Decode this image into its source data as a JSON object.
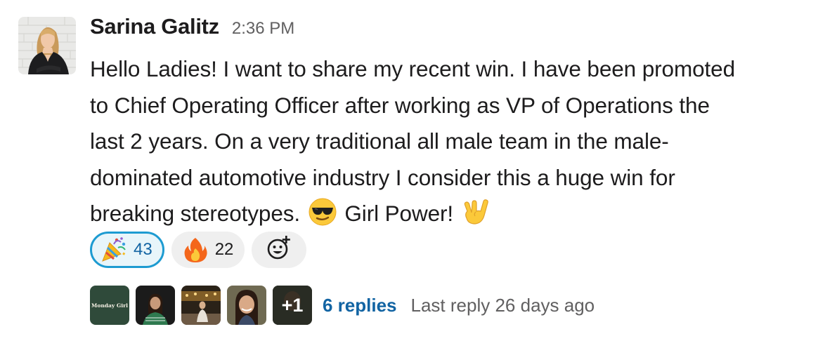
{
  "message": {
    "sender": "Sarina Galitz",
    "timestamp": "2:36 PM",
    "body_lines": [
      "Hello Ladies! I want to share my recent win. I have been promoted",
      "to Chief Operating Officer after working as VP of Operations the",
      "last 2 years. On a very traditional all male team in the male-",
      "dominated automotive industry I consider this a huge win for",
      "breaking stereotypes."
    ],
    "body_tail": "Girl Power!",
    "inline_emoji": [
      "sunglasses-emoji",
      "rock-on-hand-emoji"
    ]
  },
  "reactions": [
    {
      "emoji": "party-popper-emoji",
      "count": "43",
      "reacted_by_me": true
    },
    {
      "emoji": "fire-emoji",
      "count": "22",
      "reacted_by_me": false
    }
  ],
  "add_reaction_icon": "add-reaction-icon",
  "thread": {
    "participant_avatars": [
      "avatar-monday-girl",
      "avatar-2",
      "avatar-3",
      "avatar-4"
    ],
    "brand_avatar_text": "Monday Girl",
    "more_count": "+1",
    "reply_count": "6 replies",
    "last_reply": "Last reply 26 days ago"
  },
  "colors": {
    "link": "#1264a3",
    "muted": "#616061",
    "reacted_border": "#1d9bd1",
    "reacted_bg": "#e8f5fa",
    "pill_bg": "#efefef"
  }
}
